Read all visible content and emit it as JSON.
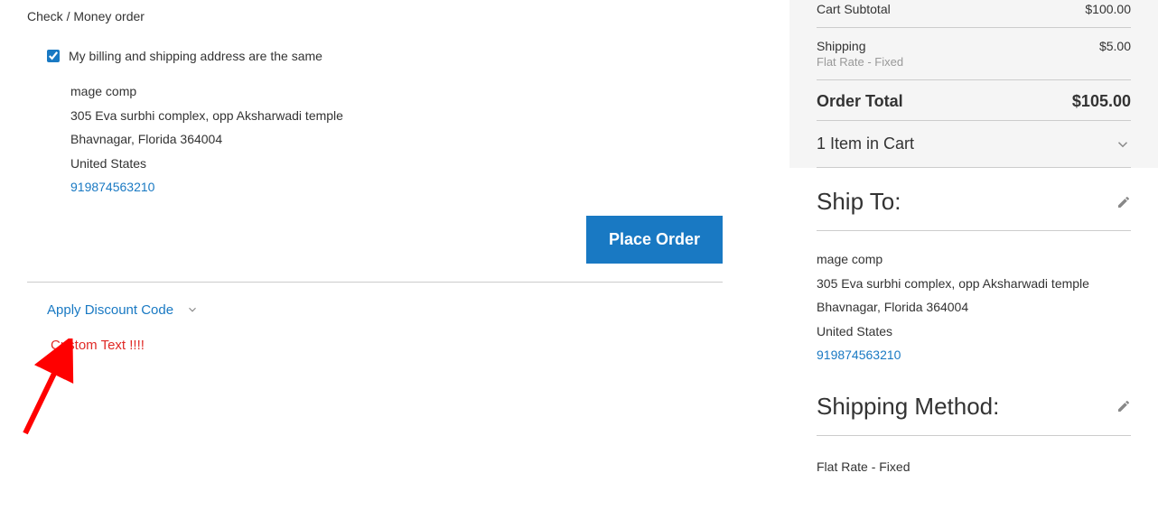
{
  "payment": {
    "method_title": "Check / Money order",
    "billing_same_label": "My billing and shipping address are the same",
    "billing_same_checked": true,
    "address": {
      "name": "mage comp",
      "street": "305 Eva surbhi complex, opp Aksharwadi temple",
      "city_region_postal": "Bhavnagar, Florida 364004",
      "country": "United States",
      "phone": "919874563210"
    },
    "place_order_label": "Place Order",
    "discount_label": "Apply Discount Code",
    "custom_text": "Custom Text !!!!"
  },
  "summary": {
    "subtotal_label": "Cart Subtotal",
    "subtotal_value": "$100.00",
    "shipping_label": "Shipping",
    "shipping_sub": "Flat Rate - Fixed",
    "shipping_value": "$5.00",
    "total_label": "Order Total",
    "total_value": "$105.00",
    "cart_items_label": "1 Item in Cart"
  },
  "ship_to": {
    "title": "Ship To:",
    "name": "mage comp",
    "street": "305 Eva surbhi complex, opp Aksharwadi temple",
    "city_region_postal": "Bhavnagar, Florida 364004",
    "country": "United States",
    "phone": "919874563210"
  },
  "shipping_method": {
    "title": "Shipping Method:",
    "value": "Flat Rate - Fixed"
  }
}
